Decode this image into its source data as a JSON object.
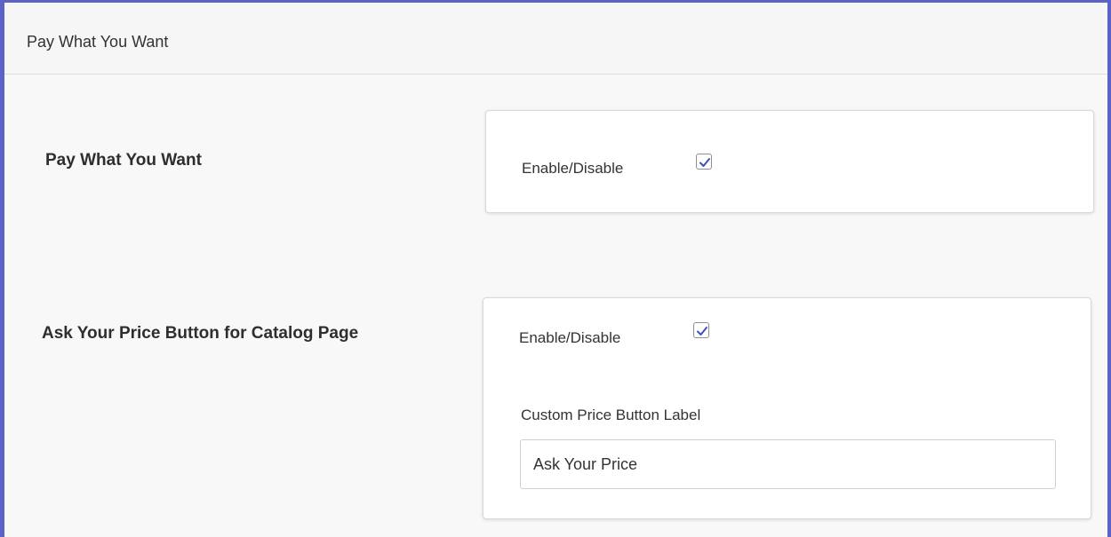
{
  "panel": {
    "title": "Pay What You Want"
  },
  "sections": [
    {
      "label": "Pay What You Want",
      "toggle_label": "Enable/Disable",
      "checked": true
    },
    {
      "label": "Ask Your Price Button for Catalog Page",
      "toggle_label": "Enable/Disable",
      "checked": true,
      "custom_label_title": "Custom Price Button Label",
      "custom_label_value": "Ask Your Price"
    }
  ],
  "colors": {
    "accent": "#5b63c9",
    "check": "#3f51b5"
  }
}
